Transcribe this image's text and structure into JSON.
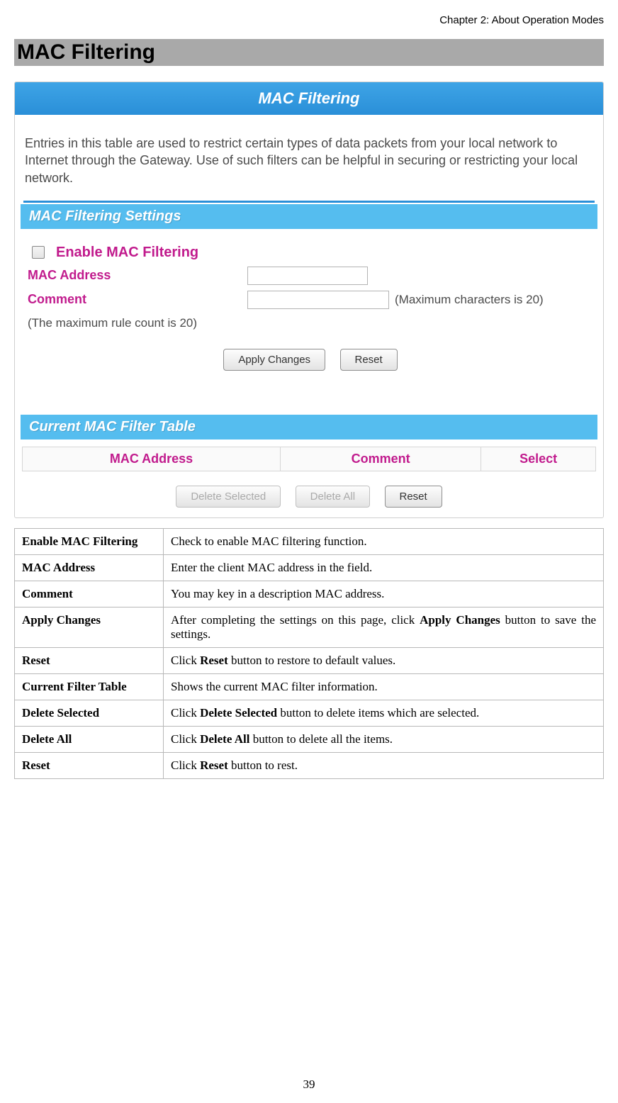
{
  "chapter_header": "Chapter 2: About Operation Modes",
  "section_title": "MAC Filtering",
  "page_number": "39",
  "screenshot": {
    "title": "MAC Filtering",
    "intro": "Entries in this table are used to restrict certain types of data packets from your local network to Internet through the Gateway. Use of such filters can be helpful in securing or restricting your local network.",
    "settings_header": "MAC Filtering Settings",
    "enable_label": "Enable MAC Filtering",
    "mac_label": "MAC Address",
    "comment_label": "Comment",
    "comment_hint": "(Maximum characters is 20)",
    "rule_note": "(The maximum rule count is 20)",
    "apply_btn": "Apply Changes",
    "reset_btn": "Reset",
    "table_header": "Current MAC Filter Table",
    "col_mac": "MAC Address",
    "col_comment": "Comment",
    "col_select": "Select",
    "del_sel_btn": "Delete Selected",
    "del_all_btn": "Delete All",
    "reset_btn2": "Reset"
  },
  "desc": {
    "rows": [
      {
        "key": "Enable MAC Filtering",
        "val_pre": "Check to enable MAC filtering function.",
        "bold": "",
        "val_post": ""
      },
      {
        "key": "MAC Address",
        "val_pre": "Enter the client MAC address in the field.",
        "bold": "",
        "val_post": ""
      },
      {
        "key": "Comment",
        "val_pre": "You may key in a description MAC address.",
        "bold": "",
        "val_post": ""
      },
      {
        "key": "Apply Changes",
        "val_pre": "After completing the settings on this page, click ",
        "bold": "Apply Changes",
        "val_post": " button to save the settings."
      },
      {
        "key": "Reset",
        "val_pre": "Click ",
        "bold": "Reset",
        "val_post": " button to restore to default values."
      },
      {
        "key": "Current Filter Table",
        "val_pre": "Shows the current MAC filter information.",
        "bold": "",
        "val_post": ""
      },
      {
        "key": "Delete Selected",
        "val_pre": "Click ",
        "bold": "Delete Selected",
        "val_post": " button to delete items which are selected."
      },
      {
        "key": "Delete All",
        "val_pre": "Click ",
        "bold": "Delete All",
        "val_post": " button to delete all the items."
      },
      {
        "key": "Reset",
        "val_pre": "Click ",
        "bold": "Reset",
        "val_post": " button to rest."
      }
    ]
  }
}
